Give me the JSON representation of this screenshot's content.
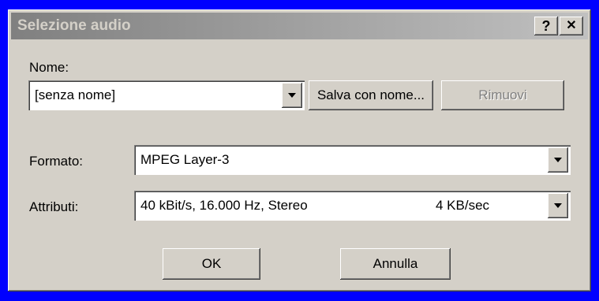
{
  "dialog": {
    "title": "Selezione audio",
    "help_label": "?",
    "close_label": "✕"
  },
  "nome": {
    "label": "Nome:",
    "value": "[senza nome]",
    "save_as_label": "Salva con nome...",
    "remove_label": "Rimuovi"
  },
  "formato": {
    "label": "Formato:",
    "value": "MPEG Layer-3"
  },
  "attributi": {
    "label": "Attributi:",
    "value": "40 kBit/s, 16.000 Hz, Stereo",
    "rate": "4 KB/sec"
  },
  "buttons": {
    "ok_label": "OK",
    "cancel_label": "Annulla"
  }
}
